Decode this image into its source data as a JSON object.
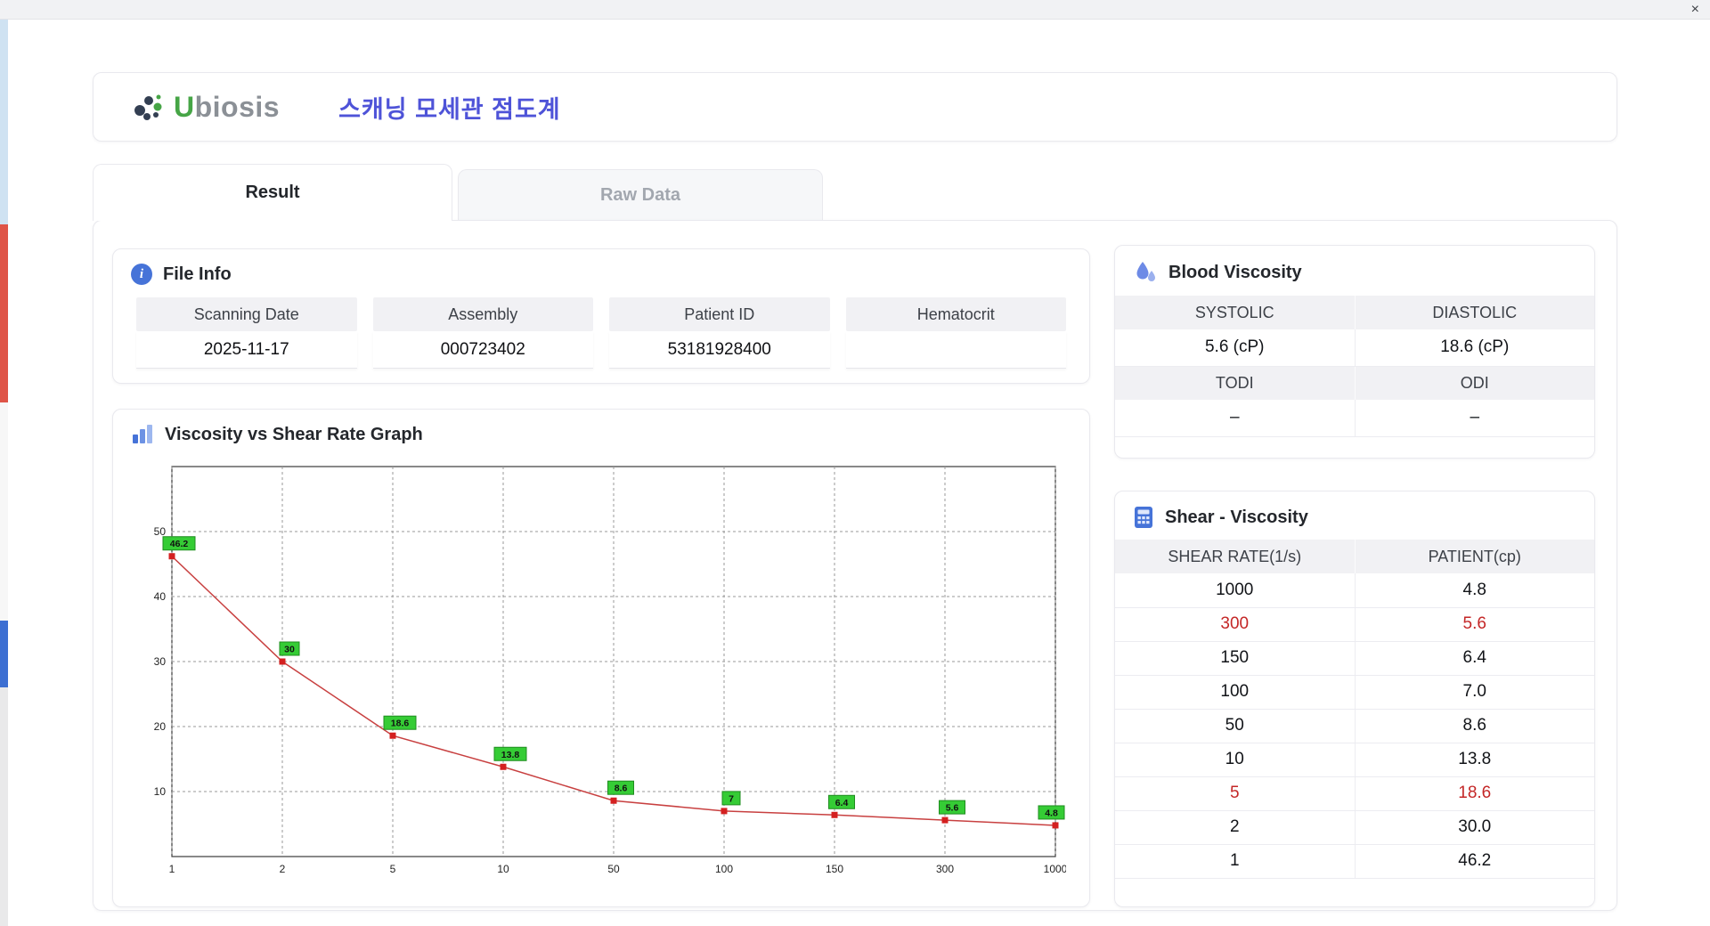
{
  "window": {
    "close_label": "×"
  },
  "header": {
    "logo_u": "U",
    "logo_rest": "biosis",
    "title": "스캐닝 모세관 점도계"
  },
  "tabs": [
    {
      "label": "Result",
      "active": true
    },
    {
      "label": "Raw Data",
      "active": false
    }
  ],
  "file_info": {
    "section_title": "File Info",
    "fields": [
      {
        "label": "Scanning Date",
        "value": "2025-11-17"
      },
      {
        "label": "Assembly",
        "value": "000723402"
      },
      {
        "label": "Patient ID",
        "value": "53181928400"
      },
      {
        "label": "Hematocrit",
        "value": ""
      }
    ]
  },
  "blood_viscosity": {
    "section_title": "Blood Viscosity",
    "rows": [
      {
        "labels": [
          "SYSTOLIC",
          "DIASTOLIC"
        ],
        "values": [
          "5.6 (cP)",
          "18.6 (cP)"
        ]
      },
      {
        "labels": [
          "TODI",
          "ODI"
        ],
        "values": [
          "–",
          "–"
        ]
      }
    ]
  },
  "graph": {
    "section_title": "Viscosity vs Shear Rate Graph"
  },
  "chart_data": {
    "type": "line",
    "title": "Viscosity vs Shear Rate Graph",
    "xlabel": "",
    "ylabel": "",
    "x": [
      1,
      2,
      5,
      10,
      50,
      100,
      150,
      300,
      1000
    ],
    "values": [
      46.2,
      30,
      18.6,
      13.8,
      8.6,
      7,
      6.4,
      5.6,
      4.8
    ],
    "labels": [
      "46.2",
      "30",
      "18.6",
      "13.8",
      "8.6",
      "7",
      "6.4",
      "5.6",
      "4.8"
    ],
    "yticks": [
      10,
      20,
      30,
      40,
      50
    ],
    "ylim": [
      0,
      60
    ],
    "grid": "dashed",
    "legend": "none",
    "line_color": "#c84040",
    "marker_color": "#d42020",
    "label_bg": "#35cc35",
    "label_border": "#1f8c1f"
  },
  "shear_viscosity": {
    "section_title": "Shear - Viscosity",
    "columns": [
      "SHEAR RATE(1/s)",
      "PATIENT(cp)"
    ],
    "rows": [
      {
        "shear": "1000",
        "patient": "4.8",
        "highlight": false
      },
      {
        "shear": "300",
        "patient": "5.6",
        "highlight": true
      },
      {
        "shear": "150",
        "patient": "6.4",
        "highlight": false
      },
      {
        "shear": "100",
        "patient": "7.0",
        "highlight": false
      },
      {
        "shear": "50",
        "patient": "8.6",
        "highlight": false
      },
      {
        "shear": "10",
        "patient": "13.8",
        "highlight": false
      },
      {
        "shear": "5",
        "patient": "18.6",
        "highlight": true
      },
      {
        "shear": "2",
        "patient": "30.0",
        "highlight": false
      },
      {
        "shear": "1",
        "patient": "46.2",
        "highlight": false
      }
    ]
  }
}
